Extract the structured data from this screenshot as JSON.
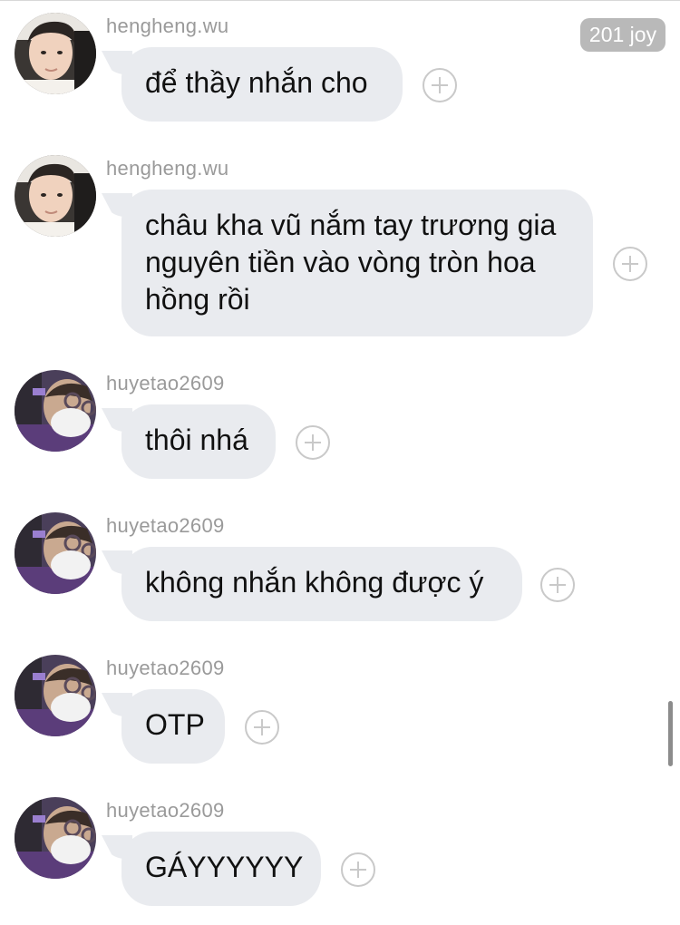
{
  "badge": {
    "label": "201 joy"
  },
  "messages": [
    {
      "username": "hengheng.wu",
      "text": "để thầy nhắn cho",
      "avatar": "person-portrait"
    },
    {
      "username": "hengheng.wu",
      "text": "châu kha vũ nắm tay trương gia nguyên tiền vào vòng tròn hoa hồng rồi",
      "avatar": "person-portrait"
    },
    {
      "username": "huyetao2609",
      "text": "thôi nhá",
      "avatar": "masked-person-photo"
    },
    {
      "username": "huyetao2609",
      "text": "không nhắn không được ý",
      "avatar": "masked-person-photo"
    },
    {
      "username": "huyetao2609",
      "text": "OTP",
      "avatar": "masked-person-photo"
    },
    {
      "username": "huyetao2609",
      "text": "GÁYYYYYY",
      "avatar": "masked-person-photo"
    }
  ],
  "colors": {
    "bubble": "#e9ebef",
    "username": "#9a9a9a",
    "badge": "#b9b9b9"
  },
  "icons": {
    "react": "add-reaction-icon",
    "scrollbar": "scrollbar"
  }
}
